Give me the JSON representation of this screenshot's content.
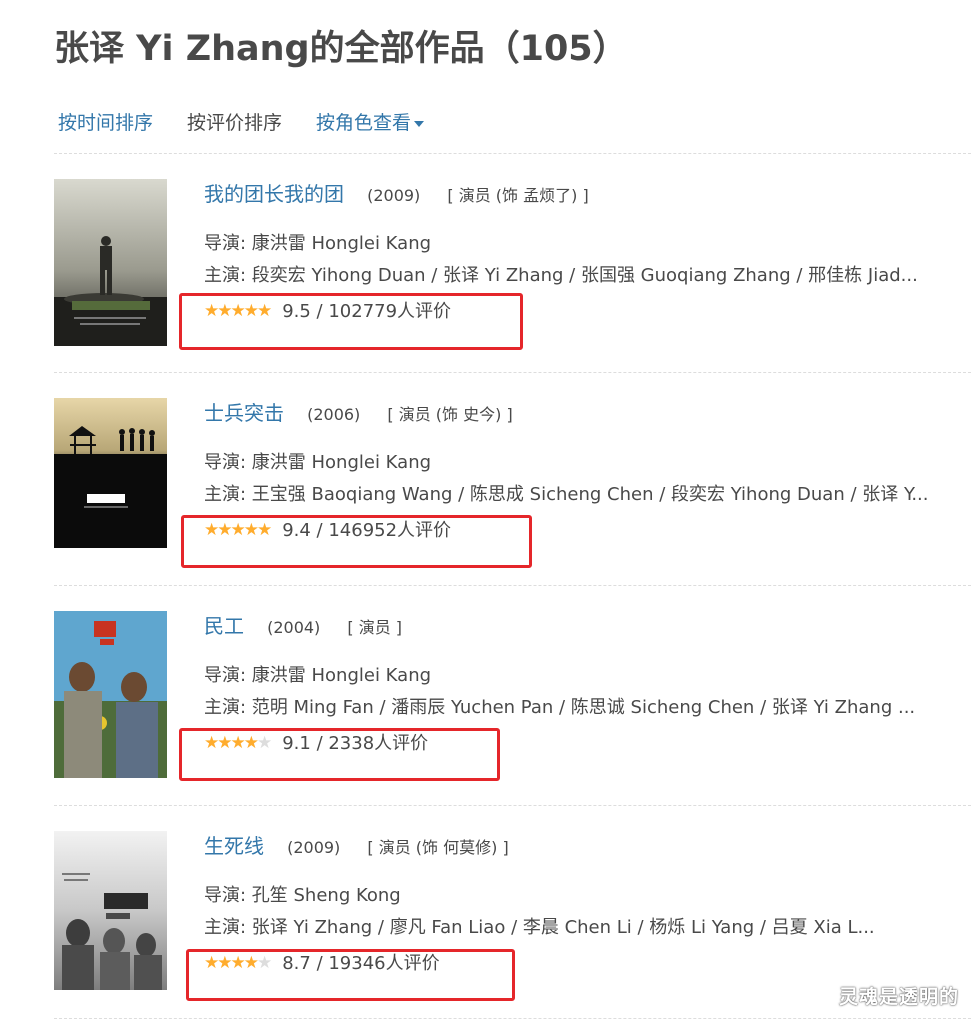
{
  "page": {
    "title": "张译 Yi Zhang的全部作品（105）"
  },
  "sort": {
    "by_time": "按时间排序",
    "by_rating": "按评价排序",
    "by_role": "按角色查看"
  },
  "items": [
    {
      "title": "我的团长我的团",
      "year": "(2009)",
      "role": "[ 演员 (饰 孟烦了) ]",
      "director": "导演: 康洪雷 Honglei Kang",
      "cast": "主演: 段奕宏 Yihong Duan / 张译 Yi Zhang / 张国强 Guoqiang Zhang / 邢佳栋 Jiad...",
      "stars": 5,
      "rating": "9.5 / 102779人评价"
    },
    {
      "title": "士兵突击",
      "year": "(2006)",
      "role": "[ 演员 (饰 史今) ]",
      "director": "导演: 康洪雷 Honglei Kang",
      "cast": "主演: 王宝强 Baoqiang Wang / 陈思成 Sicheng Chen / 段奕宏 Yihong Duan / 张译 Y...",
      "stars": 5,
      "rating": "9.4 / 146952人评价"
    },
    {
      "title": "民工",
      "year": "(2004)",
      "role": "[ 演员 ]",
      "director": "导演: 康洪雷 Honglei Kang",
      "cast": "主演: 范明 Ming Fan / 潘雨辰 Yuchen Pan / 陈思诚 Sicheng Chen / 张译 Yi Zhang ...",
      "stars": 4.5,
      "rating": "9.1 / 2338人评价"
    },
    {
      "title": "生死线",
      "year": "(2009)",
      "role": "[ 演员 (饰 何莫修) ]",
      "director": "导演: 孔笙 Sheng Kong",
      "cast": "主演: 张译 Yi Zhang / 廖凡 Fan Liao / 李晨 Chen Li / 杨烁 Li Yang / 吕夏 Xia L...",
      "stars": 4.5,
      "rating": "8.7 / 19346人评价"
    }
  ],
  "watermark": "灵魂是透明的",
  "colors": {
    "link": "#3377aa",
    "text": "#494949",
    "star": "#ffac2d",
    "highlight_box": "#e5262a"
  }
}
